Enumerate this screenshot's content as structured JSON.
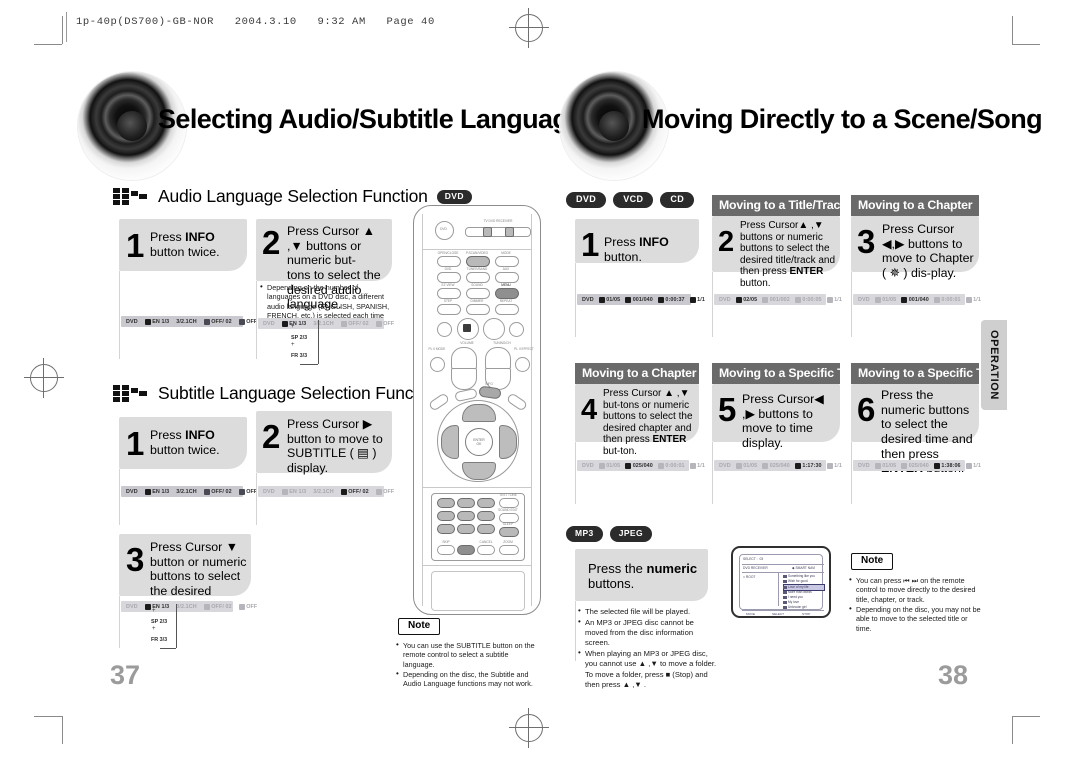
{
  "print_header": "1p-40p(DS700)-GB-NOR   2004.3.10   9:32 AM   Page 40",
  "left_page": {
    "chapter_title": "Selecting Audio/Subtitle Language",
    "folio": "37",
    "sections": [
      {
        "heading": "Audio Language Selection Function",
        "disc": "DVD",
        "steps": [
          {
            "num": "1",
            "text_html": "Press <b>INFO</b> button twice."
          },
          {
            "num": "2",
            "text_html": "Press Cursor ▲ ,▼ buttons or numeric buttons to select the desired audio language."
          }
        ],
        "note_bullets": [
          "Depending on the number of languages on a DVD disc, a different audio language (ENGLISH, SPANISH, FRENCH, etc.) is selected each time the button is pressed."
        ],
        "osd_left": [
          "DVD",
          "EN 1/3",
          "3/2.1CH",
          "OFF/ 02",
          "OFF"
        ],
        "osd_right": [
          "DVD",
          "EN 1/3",
          "3/2.1CH",
          "OFF/ 02",
          "OFF"
        ],
        "lang_chips": [
          "EN 1/3",
          "SP 2/3",
          "FR 3/3"
        ]
      },
      {
        "heading": "Subtitle Language Selection Function",
        "disc": "DVD",
        "steps": [
          {
            "num": "1",
            "text_html": "Press <b>INFO</b> button twice."
          },
          {
            "num": "2",
            "text_html": "Press Cursor ▶ button to move to SUBTITLE ( ▤ ) display."
          },
          {
            "num": "3",
            "text_html": "Press Cursor ▼ button or numeric buttons to select the desired subtitle."
          }
        ],
        "osd_left": [
          "DVD",
          "EN 1/3",
          "3/2.1CH",
          "OFF/ 02",
          "OFF"
        ],
        "osd_right": [
          "DVD",
          "EN 1/3",
          "3/2.1CH",
          "OFF/ 02",
          "OFF"
        ],
        "lang_chips": [
          "EN 1/3",
          "SP 2/3",
          "FR 3/3"
        ]
      }
    ],
    "note": {
      "tag": "Note",
      "bullets": [
        "You can use the SUBTITLE button on the remote control to select a subtitle language.",
        "Depending on the disc, the Subtitle and Audio Language functions may not work."
      ]
    },
    "remote": {
      "labels": {
        "power": "DVD",
        "tv_dvd": "TV    DVD RECEIVER",
        "row1": [
          "OPEN/CLOSE",
          "P.SCAN/VIDEO",
          "MODE"
        ],
        "row2": [
          "DVD",
          "TUNER/BAND",
          "AUX"
        ],
        "row3": [
          "EZ VIEW",
          "SUBTITLE",
          "AUDIO",
          "SOUND",
          "MENU"
        ],
        "row4": [
          "STEP",
          "DIMMER",
          "REPEAT"
        ],
        "volume": "VOLUME",
        "tuning": "TUNING/CH",
        "pl_mode": "PL II MODE",
        "pl_effect": "PL II EFFECT",
        "info": "INFO",
        "enter": "ENTER",
        "enter_sub": "OK",
        "num_extra": [
          "TEST TONE",
          "SOUND EDIT",
          "SLEEP",
          "INFO",
          "S.VOL",
          "SKIP",
          "CANCEL",
          "ZOOM",
          "LOGO",
          "SD2 MODE",
          "MO/ST",
          "REMAIN"
        ]
      }
    }
  },
  "right_page": {
    "chapter_title": "Moving Directly to a Scene/Song",
    "folio": "38",
    "side_tab": "OPERATION",
    "disc_pills": [
      "DVD",
      "VCD",
      "CD"
    ],
    "columns_top": [
      {
        "heading": null,
        "step": {
          "num": "1",
          "text_html": "Press <b>INFO</b> button."
        },
        "osd": [
          "DVD",
          "01/05",
          "001/040",
          "0:00:37",
          "1/1"
        ],
        "osd_faded": false
      },
      {
        "heading": "Moving to a Title/Track",
        "step": {
          "num": "2",
          "text_html": "Press Cursor▲ ,▼ buttons or numeric buttons to select the desired title/track and then press <b>ENTER</b> button."
        },
        "osd": [
          "DVD",
          "02/05",
          "001/002",
          "0:00:05",
          "1/1"
        ],
        "osd_faded": true
      },
      {
        "heading": "Moving to a Chapter",
        "step": {
          "num": "3",
          "text_html": "Press Cursor ◀,▶ buttons to move to Chapter ( ✵ ) display."
        },
        "osd": [
          "DVD",
          "01/05",
          "001/040",
          "0:00:01",
          "1/1"
        ],
        "osd_faded": true
      }
    ],
    "columns_bottom": [
      {
        "heading": "Moving to a Chapter",
        "step": {
          "num": "4",
          "text_html": "Press Cursor ▲ ,▼ buttons or numeric buttons to select the desired chapter and then press <b>ENTER</b> button."
        },
        "osd": [
          "DVD",
          "01/05",
          "025/040",
          "0:00:01",
          "1/1"
        ],
        "osd_faded": true
      },
      {
        "heading": "Moving to a Specific Time",
        "step": {
          "num": "5",
          "text_html": "Press Cursor◀ ,▶ buttons to move to time display."
        },
        "osd": [
          "DVD",
          "01/05",
          "025/040",
          "1:17:30",
          "1/1"
        ],
        "osd_faded": true
      },
      {
        "heading": "Moving to a Specific Time",
        "step": {
          "num": "6",
          "text_html": "Press the numeric buttons to select the desired time and then press <b>ENTER</b> button."
        },
        "osd": [
          "DVD",
          "01/05",
          "025/040",
          "1:38:06",
          "1/1"
        ],
        "osd_faded": true
      }
    ],
    "mp3_section": {
      "pills": [
        "MP3",
        "JPEG"
      ],
      "step_html": "Press the <b>numeric</b> buttons.",
      "bullets": [
        "The selected file will be played.",
        "An MP3 or JPEG disc cannot be moved from the disc information screen.",
        "When playing an MP3 or JPEG disc, you cannot use ▲ ,▼ to move a folder. To move a folder, press ■ (Stop) and then press ▲ ,▼ ."
      ],
      "screen": {
        "select_label": "SELECT :",
        "select_value": "03",
        "brand": "DVD RECEIVER",
        "smart_nav": "◆ SMART NAVI",
        "folder": "□ ROOT",
        "tracks": [
          "Something like you",
          "Wish for good",
          "Love of my life",
          "More than words",
          "I need you",
          "My love",
          "Unknown girl"
        ],
        "selected_index": 2,
        "keys": [
          "MOVE",
          "SELECT",
          "STOP"
        ]
      }
    },
    "note": {
      "tag": "Note",
      "bullets": [
        "You can press ⏮ ⏭ on the remote control to move directly to the desired title, chapter, or track.",
        "Depending on the disc, you may not be able to move to the selected title or time."
      ]
    }
  }
}
